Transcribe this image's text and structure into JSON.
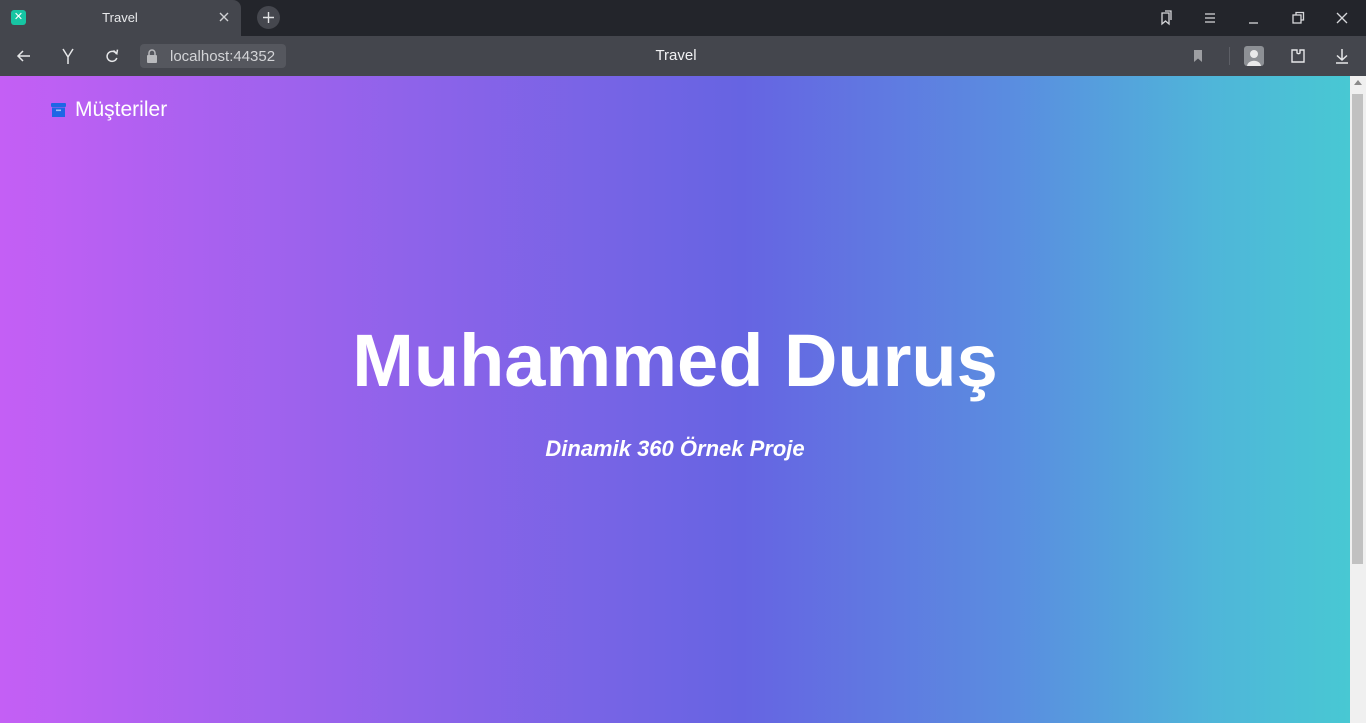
{
  "browser": {
    "tab": {
      "title": "Travel",
      "favicon": "x-icon"
    },
    "address": {
      "url": "localhost:44352"
    },
    "page_title": "Travel",
    "colors": {
      "tabbar": "#23252b",
      "toolbar": "#44464d"
    }
  },
  "page": {
    "brand": {
      "label": "Müşteriler",
      "icon": "archive-box-icon"
    },
    "hero": {
      "title": "Muhammed Duruş",
      "subtitle": "Dinamik 360 Örnek Proje"
    },
    "colors": {
      "gradient_start": "#c45ff5",
      "gradient_mid": "#6664e2",
      "gradient_end": "#48c8d3",
      "brand_icon": "#1f66e5"
    }
  }
}
